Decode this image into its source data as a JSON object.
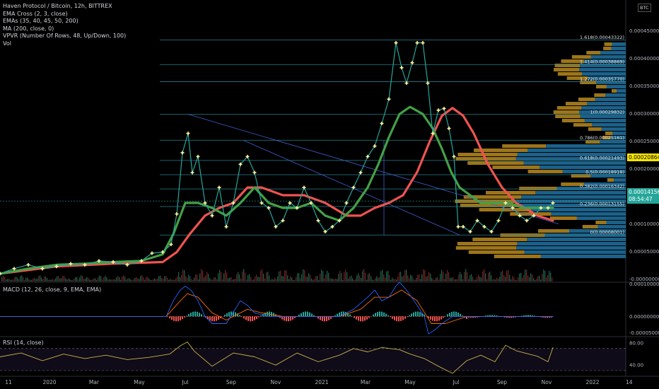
{
  "legend": {
    "title": "Haven Protocol / Bitcoin, 12h, BITTREX",
    "studies": [
      "EMA Cross (2, 3, close)",
      "EMAs (35, 40, 45, 50, 200)",
      "MA (200, close, 0)",
      "VPVR (Number Of Rows, 48, Up/Down, 100)",
      "Vol"
    ]
  },
  "currency_badge": "BTC",
  "macd_label": "MACD (12, 26, close, 9, EMA, EMA)",
  "rsi_label": "RSI (14, close)",
  "price_tags": {
    "current": "0.00014156",
    "countdown": "08:54:47",
    "alert": "0.00020864"
  },
  "colors": {
    "background": "#000000",
    "price": "#26a69a",
    "ema_fast": "#43a047",
    "ema_slow": "#ef5350",
    "marker": "#fff59d",
    "fib": "#2a7f8f",
    "vpvr_up": "#1e6b99",
    "vpvr_down": "#b88a1f",
    "macd": "#2962ff",
    "signal": "#ff6d00",
    "rsi": "#c9b24a"
  },
  "chart_data": [
    {
      "type": "line",
      "pane": "price",
      "x_ticks": [
        "11",
        "2020",
        "Mar",
        "May",
        "Jul",
        "Sep",
        "Nov",
        "2021",
        "Mar",
        "May",
        "Jul",
        "Sep",
        "Nov",
        "2022",
        "14"
      ],
      "y_ticks": [
        "0.00045000",
        "0.00040000",
        "0.00035000",
        "0.00030000",
        "0.00025000",
        "0.00020000",
        "0.00015000",
        "0.00010000",
        "0.00005000",
        "-0.00000000"
      ],
      "ylim": [
        -4.25e-06,
        0.00050555
      ],
      "fib_levels": [
        {
          "label": "1.618(0.00043322)",
          "value": 0.00043322
        },
        {
          "label": "1.414(0.00038869)",
          "value": 0.00038869
        },
        {
          "label": "1.272(0.00035770)",
          "value": 0.0003577
        },
        {
          "label": "1(0.00029832)",
          "value": 0.00029832
        },
        {
          "label": "0.786(0.00025161)",
          "value": 0.00025161
        },
        {
          "label": "0.618(0.00021493)",
          "value": 0.00021493
        },
        {
          "label": "0.5(0.00018918)",
          "value": 0.00018918
        },
        {
          "label": "0.382(0.00016342)",
          "value": 0.00016342
        },
        {
          "label": "0.236(0.00013155)",
          "value": 0.00013155
        },
        {
          "label": "0(0.00008001)",
          "value": 8.001e-05
        }
      ],
      "series": [
        {
          "role": "price",
          "x": [
            0,
            20,
            40,
            60,
            80,
            100,
            120,
            140,
            160,
            180,
            200,
            215,
            230,
            242,
            250,
            258,
            266,
            272,
            280,
            290,
            300,
            310,
            320,
            330,
            340,
            350,
            360,
            370,
            380,
            390,
            400,
            410,
            420,
            430,
            440,
            450,
            460,
            470,
            480,
            490,
            500,
            510,
            520,
            530,
            540,
            550,
            560,
            568,
            575,
            583,
            590,
            598,
            605,
            612,
            620,
            628,
            635,
            642,
            648,
            655,
            665,
            675,
            685,
            695,
            705,
            715,
            725,
            735,
            745,
            755,
            765,
            775,
            782
          ],
          "y": [
            1e-05,
            1.9e-05,
            2.6e-05,
            1.9e-05,
            2.3e-05,
            2.8e-05,
            2.6e-05,
            3.3e-05,
            3.1e-05,
            2.6e-05,
            3.3e-05,
            4.7e-05,
            4.9e-05,
            6.3e-05,
            0.000118,
            0.000229,
            0.000264,
            0.000193,
            0.000222,
            0.000138,
            0.000115,
            0.000166,
            9.5e-05,
            0.000138,
            0.000208,
            0.000222,
            0.000193,
            0.000138,
            0.000129,
            9.5e-05,
            0.000106,
            0.000138,
            0.000129,
            0.000166,
            0.000138,
            0.000106,
            8.6e-05,
            9.5e-05,
            0.000106,
            0.000138,
            0.000166,
            0.000193,
            0.000222,
            0.000241,
            0.000282,
            0.000326,
            0.000428,
            0.000383,
            0.000355,
            0.000392,
            0.000428,
            0.000428,
            0.000355,
            0.000264,
            0.000306,
            0.000309,
            0.000273,
            0.000222,
            9.5e-05,
            9.5e-05,
            8.6e-05,
            0.000106,
            9.5e-05,
            8.6e-05,
            0.000106,
            0.000138,
            0.000129,
            0.000115,
            0.000106,
            0.000115,
            0.000129,
            0.000129,
            0.000138
          ]
        },
        {
          "role": "ema_fast",
          "x": [
            0,
            40,
            80,
            120,
            160,
            200,
            230,
            245,
            262,
            280,
            300,
            320,
            340,
            360,
            380,
            400,
            420,
            440,
            460,
            480,
            500,
            520,
            535,
            550,
            565,
            580,
            598,
            612,
            625,
            638,
            650,
            665,
            680,
            700,
            720,
            740,
            760,
            782
          ],
          "y": [
            1e-05,
            1.9e-05,
            2.6e-05,
            2.8e-05,
            3.1e-05,
            3.3e-05,
            4.5e-05,
            8.1e-05,
            0.000138,
            0.000138,
            0.000129,
            0.000115,
            0.000138,
            0.000166,
            0.000138,
            0.000129,
            0.000129,
            0.000138,
            0.000115,
            0.000106,
            0.000129,
            0.000166,
            0.000208,
            0.000257,
            0.000299,
            0.000312,
            0.000299,
            0.000273,
            0.000236,
            0.000194,
            0.000166,
            0.000152,
            0.000138,
            0.000138,
            0.000138,
            0.000129,
            0.000129,
            0.000129
          ]
        },
        {
          "role": "ema_slow",
          "x": [
            0,
            80,
            160,
            230,
            250,
            268,
            290,
            310,
            330,
            350,
            370,
            400,
            430,
            460,
            490,
            510,
            530,
            550,
            570,
            590,
            608,
            625,
            640,
            655,
            670,
            690,
            710,
            730,
            760,
            782
          ],
          "y": [
            1e-05,
            2.3e-05,
            2.8e-05,
            3.1e-05,
            4.9e-05,
            8.1e-05,
            0.000115,
            0.000129,
            0.000138,
            0.000166,
            0.000166,
            0.000152,
            0.000152,
            0.000138,
            0.000115,
            0.000115,
            0.000129,
            0.000138,
            0.000152,
            0.000194,
            0.00025,
            0.000296,
            0.00031,
            0.000296,
            0.000264,
            0.000208,
            0.000166,
            0.000138,
            0.000115,
            0.000106
          ]
        }
      ]
    },
    {
      "type": "line",
      "pane": "macd",
      "y_ticks": [
        "0.00010000",
        "0.00000000",
        "-0.00005000"
      ],
      "ylim": [
        -6e-05,
        0.000103
      ],
      "series": [
        {
          "role": "macd",
          "x": [
            0,
            60,
            120,
            180,
            235,
            245,
            255,
            262,
            270,
            280,
            290,
            300,
            320,
            340,
            350,
            360,
            380,
            400,
            440,
            480,
            500,
            520,
            530,
            540,
            550,
            560,
            565,
            575,
            590,
            600,
            606,
            615,
            625,
            640,
            660,
            680,
            700,
            720,
            740,
            782
          ],
          "y": [
            0,
            0,
            0,
            0,
            0,
            4.8e-05,
            8.1e-05,
            9.3e-05,
            8.1e-05,
            4.8e-05,
            0,
            -2.2e-05,
            -2.2e-05,
            4.8e-05,
            3.4e-05,
            1.1e-05,
            0,
            0,
            0,
            0,
            2.2e-05,
            5.9e-05,
            8.1e-05,
            4.8e-05,
            5.9e-05,
            9.3e-05,
            0.000105,
            8.1e-05,
            3.4e-05,
            0,
            -5.4e-05,
            -4.1e-05,
            -2.2e-05,
            0,
            0,
            0,
            0,
            0,
            0,
            0
          ]
        },
        {
          "role": "signal",
          "x": [
            0,
            120,
            235,
            255,
            265,
            280,
            300,
            320,
            350,
            370,
            400,
            480,
            510,
            530,
            550,
            568,
            590,
            610,
            630,
            660,
            720,
            782
          ],
          "y": [
            0,
            0,
            0,
            4.8e-05,
            7e-05,
            5.9e-05,
            1.1e-05,
            -1.1e-05,
            2.2e-05,
            1.1e-05,
            0,
            0,
            2.2e-05,
            5.9e-05,
            5.9e-05,
            8.1e-05,
            4.8e-05,
            -2.2e-05,
            -2.2e-05,
            0,
            0,
            0
          ]
        }
      ]
    },
    {
      "type": "line",
      "pane": "rsi",
      "y_ticks": [
        "80.00",
        "40.00"
      ],
      "bands": [
        30,
        70
      ],
      "ylim": [
        22.3,
        90.3
      ],
      "series": [
        {
          "role": "rsi",
          "x": [
            0,
            30,
            60,
            90,
            120,
            150,
            180,
            210,
            240,
            255,
            265,
            275,
            300,
            330,
            360,
            390,
            420,
            450,
            480,
            500,
            520,
            540,
            565,
            580,
            600,
            620,
            640,
            660,
            680,
            700,
            715,
            730,
            760,
            775,
            782
          ],
          "y": [
            55,
            62,
            48,
            60,
            52,
            58,
            50,
            54,
            60,
            75,
            82,
            65,
            38,
            62,
            55,
            40,
            62,
            46,
            58,
            70,
            64,
            72,
            68,
            60,
            52,
            38,
            25,
            48,
            58,
            46,
            76,
            66,
            56,
            46,
            72
          ]
        }
      ]
    }
  ]
}
